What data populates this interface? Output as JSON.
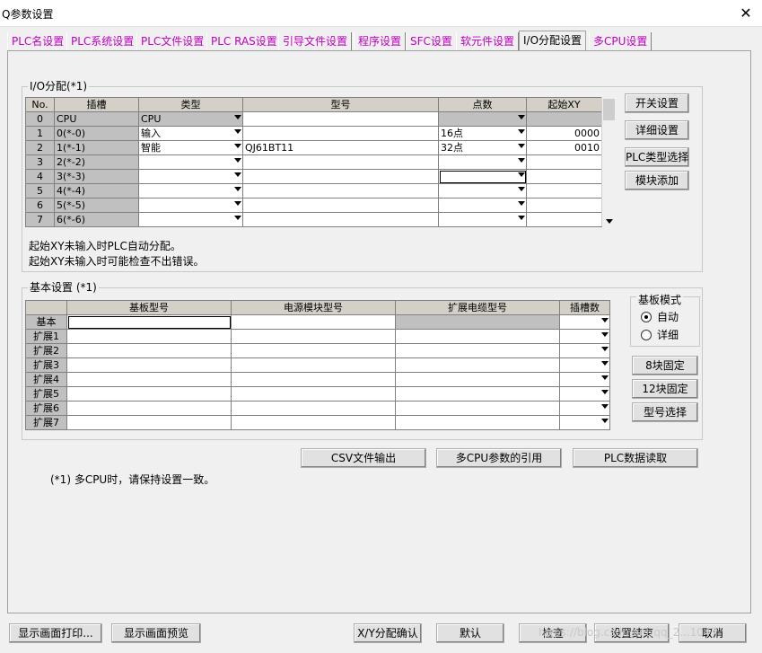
{
  "window": {
    "title": "Q参数设置",
    "close_glyph": "✕"
  },
  "tabs": [
    {
      "label": "PLC名设置"
    },
    {
      "label": "PLC系统设置"
    },
    {
      "label": "PLC文件设置"
    },
    {
      "label": "PLC RAS设置"
    },
    {
      "label": "引导文件设置"
    },
    {
      "label": "程序设置"
    },
    {
      "label": "SFC设置"
    },
    {
      "label": "软元件设置"
    },
    {
      "label": "I/O分配设置",
      "active": true
    },
    {
      "label": "多CPU设置"
    }
  ],
  "io_group": {
    "title": "I/O分配(*1)",
    "headers": [
      "No.",
      "插槽",
      "类型",
      "型号",
      "点数",
      "起始XY"
    ],
    "rows": [
      {
        "no": "0",
        "slot": "CPU",
        "type": "CPU",
        "model": "",
        "points": "",
        "start": ""
      },
      {
        "no": "1",
        "slot": "0(*-0)",
        "type": "输入",
        "model": "",
        "points": "16点",
        "start": "0000"
      },
      {
        "no": "2",
        "slot": "1(*-1)",
        "type": "智能",
        "model": "QJ61BT11",
        "points": "32点",
        "start": "0010"
      },
      {
        "no": "3",
        "slot": "2(*-2)",
        "type": "",
        "model": "",
        "points": "",
        "start": ""
      },
      {
        "no": "4",
        "slot": "3(*-3)",
        "type": "",
        "model": "",
        "points": "",
        "start": ""
      },
      {
        "no": "5",
        "slot": "4(*-4)",
        "type": "",
        "model": "",
        "points": "",
        "start": ""
      },
      {
        "no": "6",
        "slot": "5(*-5)",
        "type": "",
        "model": "",
        "points": "",
        "start": ""
      },
      {
        "no": "7",
        "slot": "6(*-6)",
        "type": "",
        "model": "",
        "points": "",
        "start": ""
      }
    ],
    "notes": [
      "起始XY未输入时PLC自动分配。",
      "起始XY未输入时可能检查不出错误。"
    ],
    "buttons": {
      "switch_settings": "开关设置",
      "detail_settings": "详细设置",
      "plc_type_select": "PLC类型选择",
      "module_add": "模块添加"
    }
  },
  "base_group": {
    "title": "基本设置 (*1)",
    "headers": [
      "",
      "基板型号",
      "电源模块型号",
      "扩展电缆型号",
      "插槽数"
    ],
    "rows": [
      {
        "label": "基本"
      },
      {
        "label": "扩展1"
      },
      {
        "label": "扩展2"
      },
      {
        "label": "扩展3"
      },
      {
        "label": "扩展4"
      },
      {
        "label": "扩展5"
      },
      {
        "label": "扩展6"
      },
      {
        "label": "扩展7"
      }
    ],
    "mode": {
      "title": "基板模式",
      "options": [
        {
          "label": "自动",
          "selected": true
        },
        {
          "label": "详细",
          "selected": false
        }
      ]
    },
    "buttons": {
      "fixed8": "8块固定",
      "fixed12": "12块固定",
      "model_select": "型号选择"
    }
  },
  "middle_buttons": {
    "csv_export": "CSV文件输出",
    "multicpu_ref": "多CPU参数的引用",
    "plc_read": "PLC数据读取"
  },
  "footnote": "(*1) 多CPU时，请保持设置一致。",
  "bottom_buttons": {
    "print": "显示画面打印...",
    "preview": "显示画面预览",
    "xy_confirm": "X/Y分配确认",
    "default": "默认",
    "check": "检查",
    "finish": "设置结束",
    "cancel": "取消"
  },
  "watermark": "https://blog.csdn.net/qq_2...1047"
}
